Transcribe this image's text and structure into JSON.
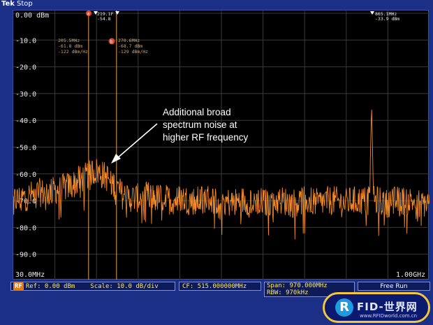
{
  "header": {
    "brand": "Tek",
    "run_state": "Stop"
  },
  "markers": {
    "ref_readout": {
      "freq": "219.1F",
      "level": "-54.8"
    },
    "right_readout": {
      "freq": "865.1MHz",
      "level": "-33.9 dBm"
    },
    "a": {
      "label": "a",
      "freq": "205.5MHz",
      "power": "-61.8 dBm",
      "density": "-122 dBm/Hz",
      "freq_mhz": 205.5,
      "level_db": -61.8
    },
    "b": {
      "label": "b",
      "freq": "270.6MHz",
      "power": "-68.7 dBm",
      "density": "-129 dBm/Hz",
      "freq_mhz": 270.6,
      "level_db": -68.7
    }
  },
  "annotation": {
    "lines": [
      "Additional broad",
      "spectrum noise at",
      "higher RF frequency"
    ]
  },
  "footer": {
    "rf_badge": "RF",
    "ref": "Ref: 0.00 dBm",
    "scale": "Scale: 10.0 dB/div",
    "cf": "CF: 515.000000MHz",
    "span": "Span:    970.000MHz",
    "rbw": "RBW:     970kHz",
    "mode": "Free Run"
  },
  "watermark": {
    "letter": "R",
    "name": "FID-世界网",
    "url": "www.RFIDworld.com.cn"
  },
  "colors": {
    "trace": "#f08a28",
    "marker": "#e9a050",
    "background": "#000000",
    "frame": "#1b2f86",
    "readout": "#ffe860"
  },
  "chart_data": {
    "type": "line",
    "title": "",
    "xlabel": "",
    "ylabel": "",
    "x_start_label": "30.0MHz",
    "x_end_label": "1.00GHz",
    "xlim_mhz": [
      30,
      1000
    ],
    "ylim": [
      -100,
      0
    ],
    "y_ticks": [
      0,
      -10,
      -20,
      -30,
      -40,
      -50,
      -60,
      -70,
      -80,
      -90
    ],
    "y_tick_labels": [
      "0.00 dBm",
      "-10.0",
      "-20.0",
      "-30.0",
      "-40.0",
      "-50.0",
      "-60.0",
      "-70.0",
      "-80.0",
      "-90.0"
    ],
    "grid": true,
    "series": [
      {
        "x_mhz": [
          30,
          50,
          70,
          90,
          110,
          130,
          150,
          170,
          185,
          200,
          205,
          215,
          225,
          235,
          245,
          255,
          265,
          275,
          285,
          300,
          320,
          340,
          360,
          380,
          400,
          420,
          440,
          460,
          480,
          500,
          520,
          540,
          560,
          580,
          600,
          620,
          640,
          660,
          680,
          700,
          720,
          740,
          760,
          780,
          800,
          820,
          840,
          860,
          865,
          870,
          880,
          900,
          920,
          940,
          960,
          980,
          1000
        ],
        "y_db": [
          -70,
          -69,
          -68,
          -67,
          -67,
          -66,
          -65,
          -64,
          -62,
          -61,
          -60,
          -59,
          -59,
          -60,
          -61,
          -62,
          -64,
          -66,
          -68,
          -69,
          -69,
          -68,
          -69,
          -69,
          -70,
          -69,
          -70,
          -70,
          -69,
          -70,
          -70,
          -71,
          -70,
          -70,
          -70,
          -71,
          -70,
          -70,
          -71,
          -70,
          -70,
          -71,
          -70,
          -70,
          -71,
          -70,
          -70,
          -70,
          -34,
          -70,
          -70,
          -71,
          -70,
          -70,
          -70,
          -71,
          -71
        ]
      }
    ]
  }
}
